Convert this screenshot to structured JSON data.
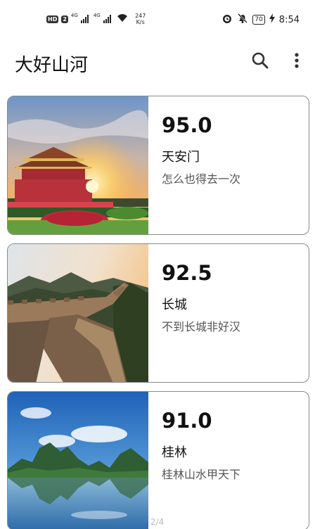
{
  "status_bar": {
    "left_badges": [
      "HD",
      "2",
      "4G",
      "4G"
    ],
    "network_speed": "247",
    "network_unit": "K/s",
    "battery": "70",
    "time": "8:54"
  },
  "header": {
    "title": "大好山河",
    "search_icon": "search-icon",
    "more_icon": "more-vert-icon"
  },
  "places": [
    {
      "score": "95.0",
      "name": "天安门",
      "desc": "怎么也得去一次",
      "image": "tiananmen-photo"
    },
    {
      "score": "92.5",
      "name": "长城",
      "desc": "不到长城非好汉",
      "image": "great-wall-photo"
    },
    {
      "score": "91.0",
      "name": "桂林",
      "desc": "桂林山水甲天下",
      "image": "guilin-photo"
    }
  ],
  "pager": {
    "text": "2/4"
  }
}
